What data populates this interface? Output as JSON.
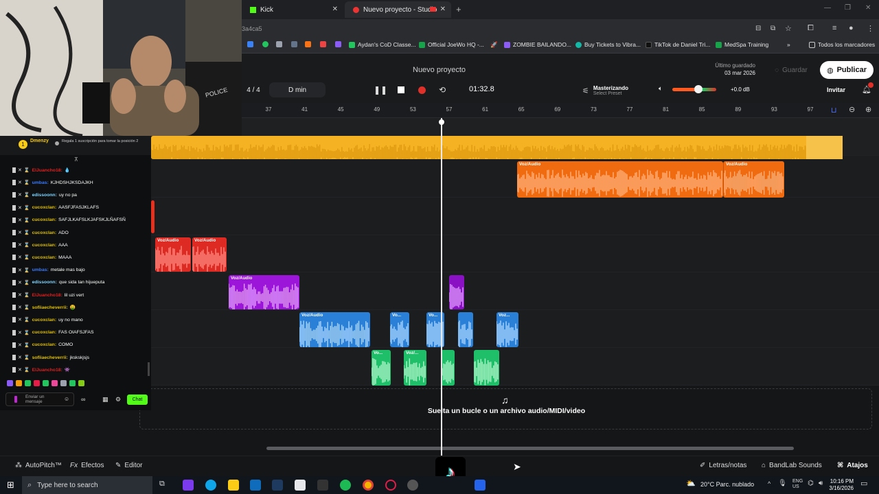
{
  "browser": {
    "tabs": [
      {
        "label": "Kick"
      },
      {
        "label": "Nuevo proyecto - Studio"
      }
    ],
    "url_fragment": "3a4ca5",
    "bookmarks": [
      "Aydan's CoD Classe...",
      "Official JoeWo HQ -...",
      "ZOMBIE BAILANDO...",
      "Buy Tickets to Vibra...",
      "TikTok de Daniel Tri...",
      "MedSpa Training"
    ],
    "all_bookmarks": "Todos los marcadores"
  },
  "studio": {
    "project_title": "Nuevo proyecto",
    "last_saved_label": "Último guardado",
    "last_saved_date": "03 mar 2026",
    "save_label": "Guardar",
    "publish_label": "Publicar",
    "invite_label": "Invitar",
    "time_signature": "4 / 4",
    "key": "D min",
    "time_display": "01:32.8",
    "mastering_label": "Masterizando",
    "select_preset": "Select Preset",
    "volume_db": "+0.0 dB",
    "volume_level": 0.6,
    "ruler_ticks": [
      "37",
      "41",
      "45",
      "49",
      "53",
      "57",
      "61",
      "65",
      "69",
      "73",
      "77",
      "81",
      "85",
      "89",
      "93",
      "97"
    ],
    "drop_text": "Suelta un bucle o un archivo audio/MIDI/video",
    "bottom": {
      "autopitch": "AutoPitch™",
      "effects": "Efectos",
      "editor": "Editor",
      "lyrics": "Letras/notas",
      "bandlab_sounds": "BandLab Sounds",
      "shortcuts": "Atajos"
    },
    "clip_label": "Voz/Audio",
    "clip_label_short": "Vo...",
    "clip_label_mid": "Voz/...",
    "clip_label_mid2": "Voz..."
  },
  "chat": {
    "header_user": "Dmenzy",
    "header_count": "1",
    "header_gift_text": "Regala 1 suscripción para tomar la posición 2",
    "messages": [
      {
        "user": "ElJuancho18:",
        "text": "💧",
        "color": "#e02020"
      },
      {
        "user": "umbas:",
        "text": "KJHDSHJKSDAJKH",
        "color": "#3a7bff"
      },
      {
        "user": "edissoonn:",
        "text": "uy no pa",
        "color": "#7fd4ff"
      },
      {
        "user": "cucoxclan:",
        "text": "AASFJFASJKLAFS",
        "color": "#e0c000"
      },
      {
        "user": "cucoxclan:",
        "text": "SAFJLKAFSLKJAFSKJLÑAFSÑ",
        "color": "#e0c000"
      },
      {
        "user": "cucoxclan:",
        "text": "ADO",
        "color": "#e0c000"
      },
      {
        "user": "cucoxclan:",
        "text": "AAA",
        "color": "#e0c000"
      },
      {
        "user": "cucoxclan:",
        "text": "MAAA",
        "color": "#e0c000"
      },
      {
        "user": "umbas:",
        "text": "metale mas bajo",
        "color": "#3a7bff"
      },
      {
        "user": "edissoonn:",
        "text": "que sida tan hijueputa",
        "color": "#7fd4ff"
      },
      {
        "user": "ElJuancho18:",
        "text": "lil uzi vert",
        "color": "#e02020"
      },
      {
        "user": "sofiiaecheverrii:",
        "text": "🤑",
        "color": "#e0c000"
      },
      {
        "user": "cucoxclan:",
        "text": "uy no mano",
        "color": "#e0c000"
      },
      {
        "user": "cucoxclan:",
        "text": "FAS OIAFSJFAS",
        "color": "#e0c000"
      },
      {
        "user": "cucoxclan:",
        "text": "COMO",
        "color": "#e0c000"
      },
      {
        "user": "sofiiaecheverrii:",
        "text": "jkskskjsjs",
        "color": "#e0c000"
      },
      {
        "user": "ElJuancho18:",
        "text": "👾",
        "color": "#e02020"
      }
    ],
    "input_placeholder": "Enviar un mensaje",
    "send_label": "Chat"
  },
  "taskbar": {
    "search_placeholder": "Type here to search",
    "weather": "20°C  Parc. nublado",
    "lang1": "ENG",
    "lang2": "US",
    "time": "10:16 PM",
    "date": "3/16/2026"
  },
  "colors": {
    "orange_track": "#f5a623",
    "publish_bg": "#ffffff",
    "send_btn": "#53fc18",
    "record": "#e0302a"
  }
}
